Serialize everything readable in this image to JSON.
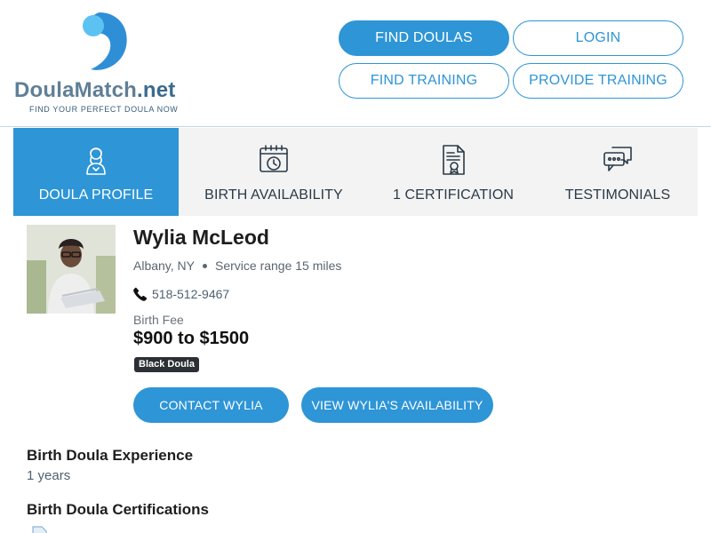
{
  "brand": {
    "name_part1": "Doula",
    "name_part2": "Match",
    "name_part3": ".net",
    "tagline": "FIND YOUR PERFECT DOULA NOW",
    "colors": {
      "primary": "#2e95d6",
      "logo_blue": "#2e8fd6",
      "logo_light": "#5cc2f2"
    }
  },
  "nav": {
    "find_doulas": "FIND DOULAS",
    "login": "LOGIN",
    "find_training": "FIND TRAINING",
    "provide_training": "PROVIDE TRAINING"
  },
  "tabs": [
    {
      "label": "DOULA PROFILE",
      "icon": "doula-person-icon",
      "active": true
    },
    {
      "label": "BIRTH AVAILABILITY",
      "icon": "calendar-clock-icon",
      "active": false
    },
    {
      "label": "1 CERTIFICATION",
      "icon": "certificate-document-icon",
      "active": false
    },
    {
      "label": "TESTIMONIALS",
      "icon": "chat-bubbles-icon",
      "active": false
    }
  ],
  "profile": {
    "name": "Wylia McLeod",
    "city": "Albany, NY",
    "service_range": "Service range 15 miles",
    "phone": "518-512-9467",
    "fee_label": "Birth Fee",
    "fee_value": "$900 to $1500",
    "badge": "Black Doula",
    "contact_button": "CONTACT WYLIA",
    "availability_button": "VIEW WYLIA'S AVAILABILITY"
  },
  "sections": {
    "experience_title": "Birth Doula Experience",
    "experience_value": "1 years",
    "certifications_title": "Birth Doula Certifications"
  }
}
